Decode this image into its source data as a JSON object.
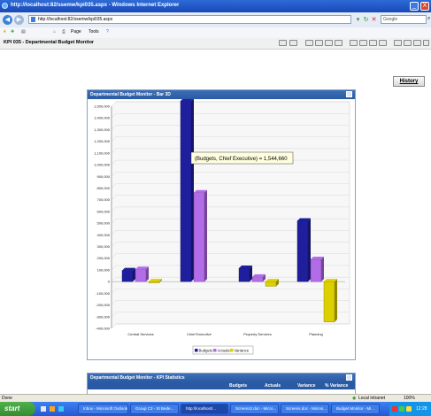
{
  "window": {
    "title": "http://localhost:82/ssemw/kpi035.aspx - Windows Internet Explorer",
    "btn_min": "_",
    "btn_close": "X"
  },
  "address": {
    "url": "http://localhost:82/ssemw/kpi035.aspx",
    "search_placeholder": "Google"
  },
  "favbar": {
    "page_menu": "Page",
    "tools_menu": "Tools"
  },
  "page": {
    "title": "KPI 035 - Departmental Budget Monitor"
  },
  "history_button": "History",
  "chart_panel": {
    "title": "Departmental Budget Monitor - Bar 3D"
  },
  "chart_data": {
    "type": "bar",
    "categories": [
      "Central Services",
      "Chief Executive",
      "Property Services",
      "Planning"
    ],
    "series": [
      {
        "name": "Budgets",
        "values": [
          95000,
          1544660,
          115000,
          520000
        ],
        "color": "#1f1f9e"
      },
      {
        "name": "Actuals",
        "values": [
          105000,
          760000,
          40000,
          190000
        ],
        "color": "#b36ce8"
      },
      {
        "name": "Variance",
        "values": [
          -10000,
          0,
          -40000,
          -345000
        ],
        "color": "#ddd000"
      }
    ],
    "yticks": [
      "1,500,000",
      "1,400,000",
      "1,300,000",
      "1,200,000",
      "1,100,000",
      "1,000,000",
      "900,000",
      "800,000",
      "700,000",
      "600,000",
      "500,000",
      "400,000",
      "300,000",
      "200,000",
      "100,000",
      "0",
      "-100,000",
      "-200,000",
      "-300,000",
      "-400,000"
    ],
    "ylim": [
      -400000,
      1500000
    ],
    "tooltip": "(Budgets, Chief Executive) = 1,544,660",
    "legend_position": "bottom"
  },
  "stats_panel": {
    "title": "Departmental Budget Monitor - KPI Statistics",
    "columns": [
      "Budgets",
      "Actuals",
      "Variance",
      "% Variance"
    ]
  },
  "statusbar": {
    "left": "Done",
    "zone": "Local intranet",
    "zoom": "100%"
  },
  "taskbar": {
    "start": "start",
    "items": [
      "Inbox - Microsoft Outlook",
      "Group C3 - St Bede...",
      "http://localhost/...",
      "Screens2.doc - Micro...",
      "Screens.doc - Micros...",
      "Budget Monitor - Mi..."
    ],
    "clock": "12:28"
  }
}
